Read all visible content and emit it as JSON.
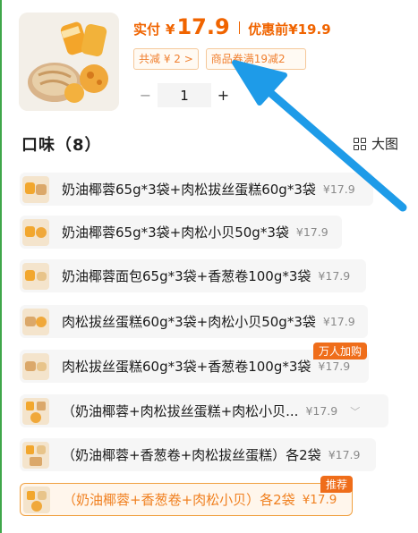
{
  "product": {
    "pay_label": "实付",
    "currency_symbol": "¥",
    "pay_price": "17.9",
    "original_label": "优惠前",
    "original_price": "¥19.9",
    "tags": {
      "total_discount": "共减 ¥ 2 >",
      "coupon": "商品券满19减2"
    }
  },
  "quantity": {
    "minus": "−",
    "value": "1",
    "plus": "+"
  },
  "flavor_section": {
    "title": "口味（8）",
    "view_toggle_label": "大图"
  },
  "options": [
    {
      "label": "奶油椰蓉65g*3袋+肉松拔丝蛋糕60g*3袋",
      "price": "¥17.9",
      "badge": "",
      "selected": false
    },
    {
      "label": "奶油椰蓉65g*3袋+肉松小贝50g*3袋",
      "price": "¥17.9",
      "badge": "",
      "selected": false
    },
    {
      "label": "奶油椰蓉面包65g*3袋+香葱卷100g*3袋",
      "price": "¥17.9",
      "badge": "",
      "selected": false
    },
    {
      "label": "肉松拔丝蛋糕60g*3袋+肉松小贝50g*3袋",
      "price": "¥17.9",
      "badge": "",
      "selected": false
    },
    {
      "label": "肉松拔丝蛋糕60g*3袋+香葱卷100g*3袋",
      "price": "¥17.9",
      "badge": "万人加购",
      "selected": false
    },
    {
      "label": "（奶油椰蓉+肉松拔丝蛋糕+肉松小贝...",
      "price": "¥17.9",
      "badge": "",
      "selected": false,
      "has_chevron": true
    },
    {
      "label": "（奶油椰蓉+香葱卷+肉松拔丝蛋糕）各2袋",
      "price": "¥17.9",
      "badge": "",
      "selected": false
    },
    {
      "label": "（奶油椰蓉+香葱卷+肉松小贝）各2袋",
      "price": "¥17.9",
      "badge": "推荐",
      "selected": true
    }
  ],
  "colors": {
    "accent": "#f06400",
    "tag_border": "#f5c89a",
    "badge": "#ef6d1a",
    "selected_border": "#f0a040",
    "arrow": "#1e9be8"
  }
}
